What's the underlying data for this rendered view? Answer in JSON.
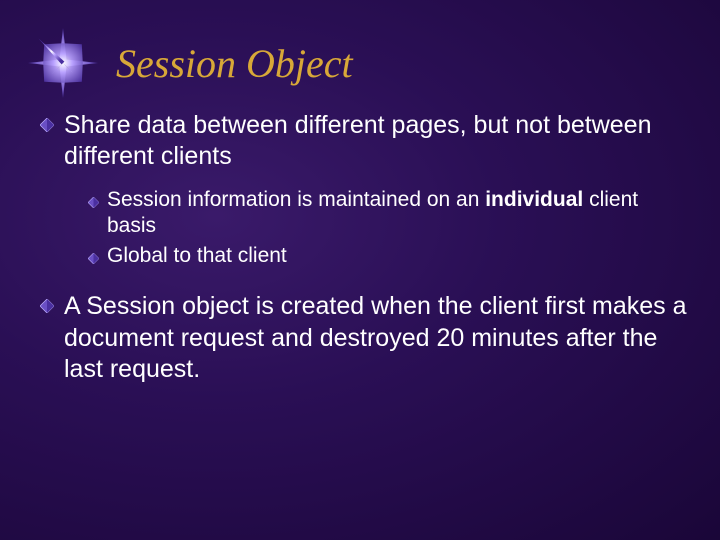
{
  "slide": {
    "title": "Session Object",
    "bullets": [
      {
        "text_before": "Share data between different pages, but not between different clients",
        "sub": [
          {
            "pre": "Session information is maintained on an ",
            "bold": "individual",
            "post": " client basis"
          },
          {
            "pre": "Global to that client",
            "bold": "",
            "post": ""
          }
        ]
      },
      {
        "text_before": "A Session object is created when the client first makes a document request and destroyed 20 minutes after the last request.",
        "sub": []
      }
    ]
  },
  "icons": {
    "star": "star-icon",
    "diamond": "diamond-bullet-icon"
  },
  "colors": {
    "title": "#d8a838",
    "bullet_fill": "#6a4fc4",
    "bullet_stroke": "#9a85e0"
  }
}
